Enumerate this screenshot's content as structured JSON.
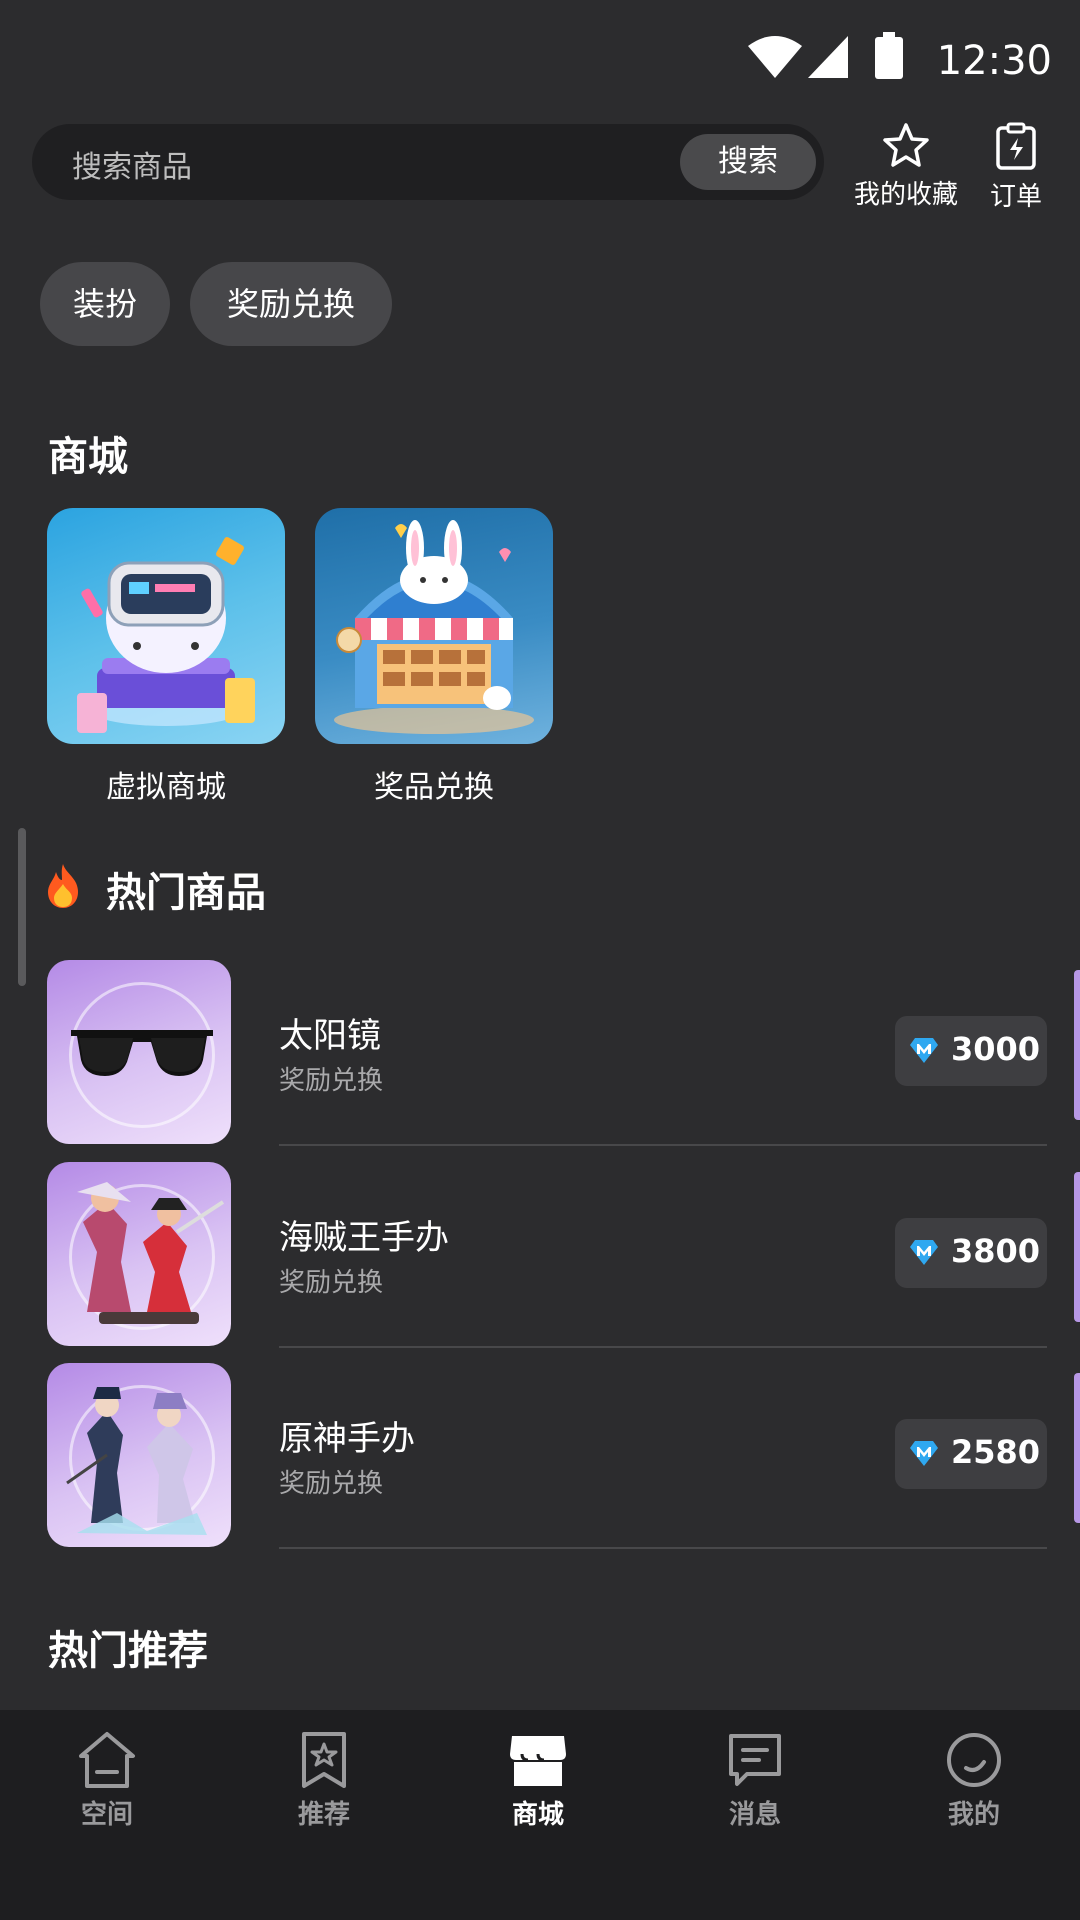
{
  "status_bar": {
    "time": "12:30",
    "icons": [
      "wifi-icon",
      "signal-icon",
      "battery-icon"
    ]
  },
  "search": {
    "placeholder": "搜索商品",
    "button": "搜索"
  },
  "top_actions": [
    {
      "label": "我的收藏",
      "icon": "star-icon"
    },
    {
      "label": "订单",
      "icon": "order-icon"
    }
  ],
  "chips": [
    "装扮",
    "奖励兑换"
  ],
  "mall": {
    "title": "商城",
    "cards": [
      {
        "label": "虚拟商城"
      },
      {
        "label": "奖品兑换"
      }
    ]
  },
  "hot": {
    "title": "热门商品",
    "icon": "fire-icon",
    "items": [
      {
        "name": "太阳镜",
        "sub": "奖励兑换",
        "price": "3000"
      },
      {
        "name": "海贼王手办",
        "sub": "奖励兑换",
        "price": "3800"
      },
      {
        "name": "原神手办",
        "sub": "奖励兑换",
        "price": "2580"
      }
    ]
  },
  "recommend": {
    "title": "热门推荐"
  },
  "nav": {
    "items": [
      {
        "label": "空间",
        "icon": "home-icon"
      },
      {
        "label": "推荐",
        "icon": "bookmark-star-icon"
      },
      {
        "label": "商城",
        "icon": "shop-icon",
        "active": true
      },
      {
        "label": "消息",
        "icon": "message-icon"
      },
      {
        "label": "我的",
        "icon": "profile-icon"
      }
    ]
  },
  "colors": {
    "background": "#2c2c2e",
    "nav_background": "#1e1e20",
    "gem": "#2fa8f0"
  }
}
